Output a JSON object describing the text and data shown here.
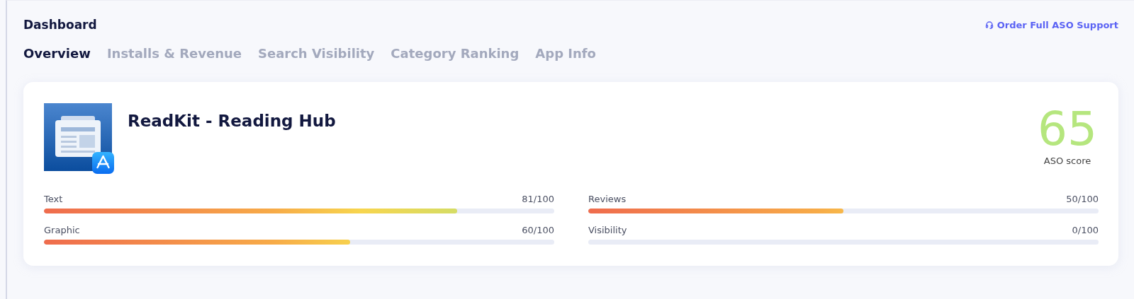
{
  "header": {
    "title": "Dashboard",
    "support_link": "Order Full ASO Support"
  },
  "tabs": [
    {
      "label": "Overview",
      "selected": true
    },
    {
      "label": "Installs & Revenue",
      "selected": false
    },
    {
      "label": "Search Visibility",
      "selected": false
    },
    {
      "label": "Category Ranking",
      "selected": false
    },
    {
      "label": "App Info",
      "selected": false
    }
  ],
  "app": {
    "name": "ReadKit - Reading Hub",
    "score": "65",
    "score_label": "ASO score"
  },
  "metrics": [
    {
      "name": "Text",
      "reading": "81/100",
      "level": 0.81
    },
    {
      "name": "Reviews",
      "reading": "50/100",
      "level": 0.5
    },
    {
      "name": "Graphic",
      "reading": "60/100",
      "level": 0.6
    },
    {
      "name": "Visibility",
      "reading": "0/100"
    }
  ]
}
